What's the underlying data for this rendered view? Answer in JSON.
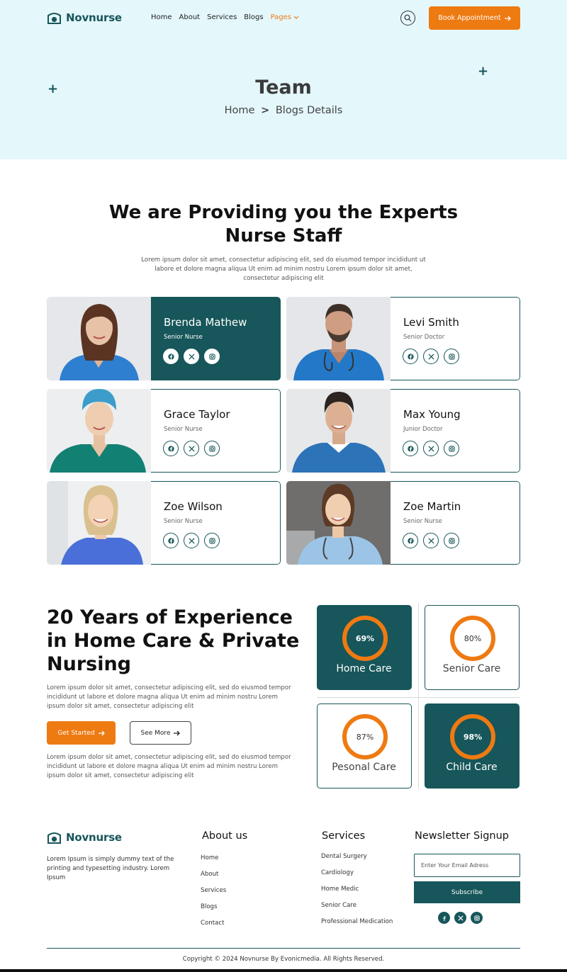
{
  "brand": {
    "name": "Novnurse",
    "color": "#17565a",
    "accent": "#ee7a12"
  },
  "nav": {
    "items": [
      {
        "label": "Home"
      },
      {
        "label": "About"
      },
      {
        "label": "Services"
      },
      {
        "label": "Blogs"
      },
      {
        "label": "Pages",
        "active": true
      }
    ],
    "search_icon": "search-icon",
    "book_label": "Book Appointment"
  },
  "hero": {
    "title": "Team",
    "breadcrumb": {
      "home": "Home",
      "separator": ">",
      "current": "Blogs Details"
    }
  },
  "team": {
    "heading_line1": "We are Providing you the Experts",
    "heading_line2": "Nurse Staff",
    "description": "Lorem ipsum dolor sit amet, consectetur adipiscing elit, sed do eiusmod tempor incididunt ut labore et dolore magna aliqua Ut enim ad minim nostru Lorem ipsum dolor sit amet, consectetur adipiscing elit",
    "members": [
      {
        "name": "Brenda Mathew",
        "role": "Senior Nurse",
        "highlight": true
      },
      {
        "name": "Levi Smith",
        "role": "Senior Doctor"
      },
      {
        "name": "Grace Taylor",
        "role": "Senior Nurse"
      },
      {
        "name": "Max Young",
        "role": "Junior Doctor"
      },
      {
        "name": "Zoe Wilson",
        "role": "Senior Nurse"
      },
      {
        "name": "Zoe Martin",
        "role": "Senior Nurse"
      }
    ],
    "social_icons": [
      "facebook-icon",
      "x-icon",
      "instagram-icon"
    ]
  },
  "experience": {
    "title": "20 Years of Experience in Home Care & Private Nursing",
    "paragraph1": "Lorem ipsum dolor sit amet, consectetur adipiscing elit, sed do eiusmod tempor incididunt ut labore et dolore magna aliqua Ut enim ad minim nostru Lorem ipsum dolor sit amet, consectetur adipiscing elit",
    "paragraph2": "Lorem ipsum dolor sit amet, consectetur adipiscing elit, sed do eiusmod tempor incididunt ut labore et dolore magna aliqua Ut enim ad minim nostru Lorem ipsum dolor sit amet, consectetur adipiscing elit",
    "get_started": "Get Started",
    "see_more": "See More",
    "stats": [
      {
        "percent": "69%",
        "label": "Home Care",
        "dark": true
      },
      {
        "percent": "80%",
        "label": "Senior Care",
        "dark": false
      },
      {
        "percent": "87%",
        "label": "Pesonal Care",
        "dark": false
      },
      {
        "percent": "98%",
        "label": "Child Care",
        "dark": true
      }
    ]
  },
  "footer": {
    "description": "Lorem Ipsum is simply dummy text of the printing and typesetting industry. Lorem Ipsum",
    "about_heading": "About us",
    "about_links": [
      "Home",
      "About",
      "Services",
      "Blogs",
      "Contact"
    ],
    "services_heading": "Services",
    "services_links": [
      "Dental Surgery",
      "Cardiology",
      "Home Medic",
      "Senior Care",
      "Professional Medication"
    ],
    "newsletter_heading": "Newsletter Signup",
    "email_placeholder": "Enter Your Email Adress",
    "subscribe_label": "Subscribe",
    "copyright": "Copyright © 2024 Novnurse By Evonicmedia. All Rights Reserved."
  }
}
